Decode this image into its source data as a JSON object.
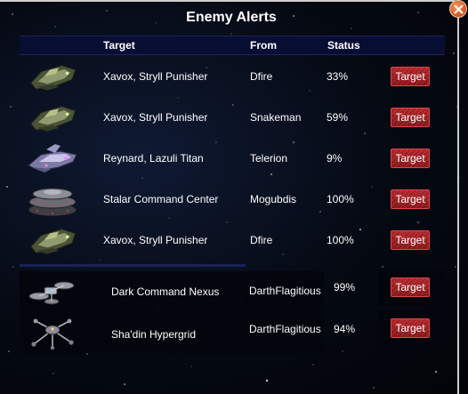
{
  "window": {
    "title": "Enemy Alerts",
    "close_icon": "close-icon"
  },
  "columns": {
    "target": "Target",
    "from": "From",
    "status": "Status"
  },
  "rows": [
    {
      "target": "Xavox, Stryll Punisher",
      "from": "Dfire",
      "status": "33%",
      "button": "Target",
      "ship_icon": "green-cruiser-ship-icon"
    },
    {
      "target": "Xavox, Stryll Punisher",
      "from": "Snakeman",
      "status": "59%",
      "button": "Target",
      "ship_icon": "green-cruiser-ship-icon"
    },
    {
      "target": "Reynard, Lazuli Titan",
      "from": "Telerion",
      "status": "9%",
      "button": "Target",
      "ship_icon": "purple-titan-ship-icon"
    },
    {
      "target": "Stalar Command Center",
      "from": "Mogubdis",
      "status": "100%",
      "button": "Target",
      "ship_icon": "command-center-station-icon"
    },
    {
      "target": "Xavox, Stryll Punisher",
      "from": "Dfire",
      "status": "100%",
      "button": "Target",
      "ship_icon": "green-cruiser-ship-icon"
    },
    {
      "target": "Dark Command Nexus",
      "from": "DarthFlagitious",
      "status": "99%",
      "button": "Target",
      "ship_icon": "nexus-station-icon"
    },
    {
      "target": "Sha'din Hypergrid",
      "from": "DarthFlagitious",
      "status": "94%",
      "button": "Target",
      "ship_icon": "hypergrid-station-icon"
    }
  ],
  "colors": {
    "header_bar": "#080d33",
    "button": "#a01e22",
    "close": "#d2531a"
  }
}
